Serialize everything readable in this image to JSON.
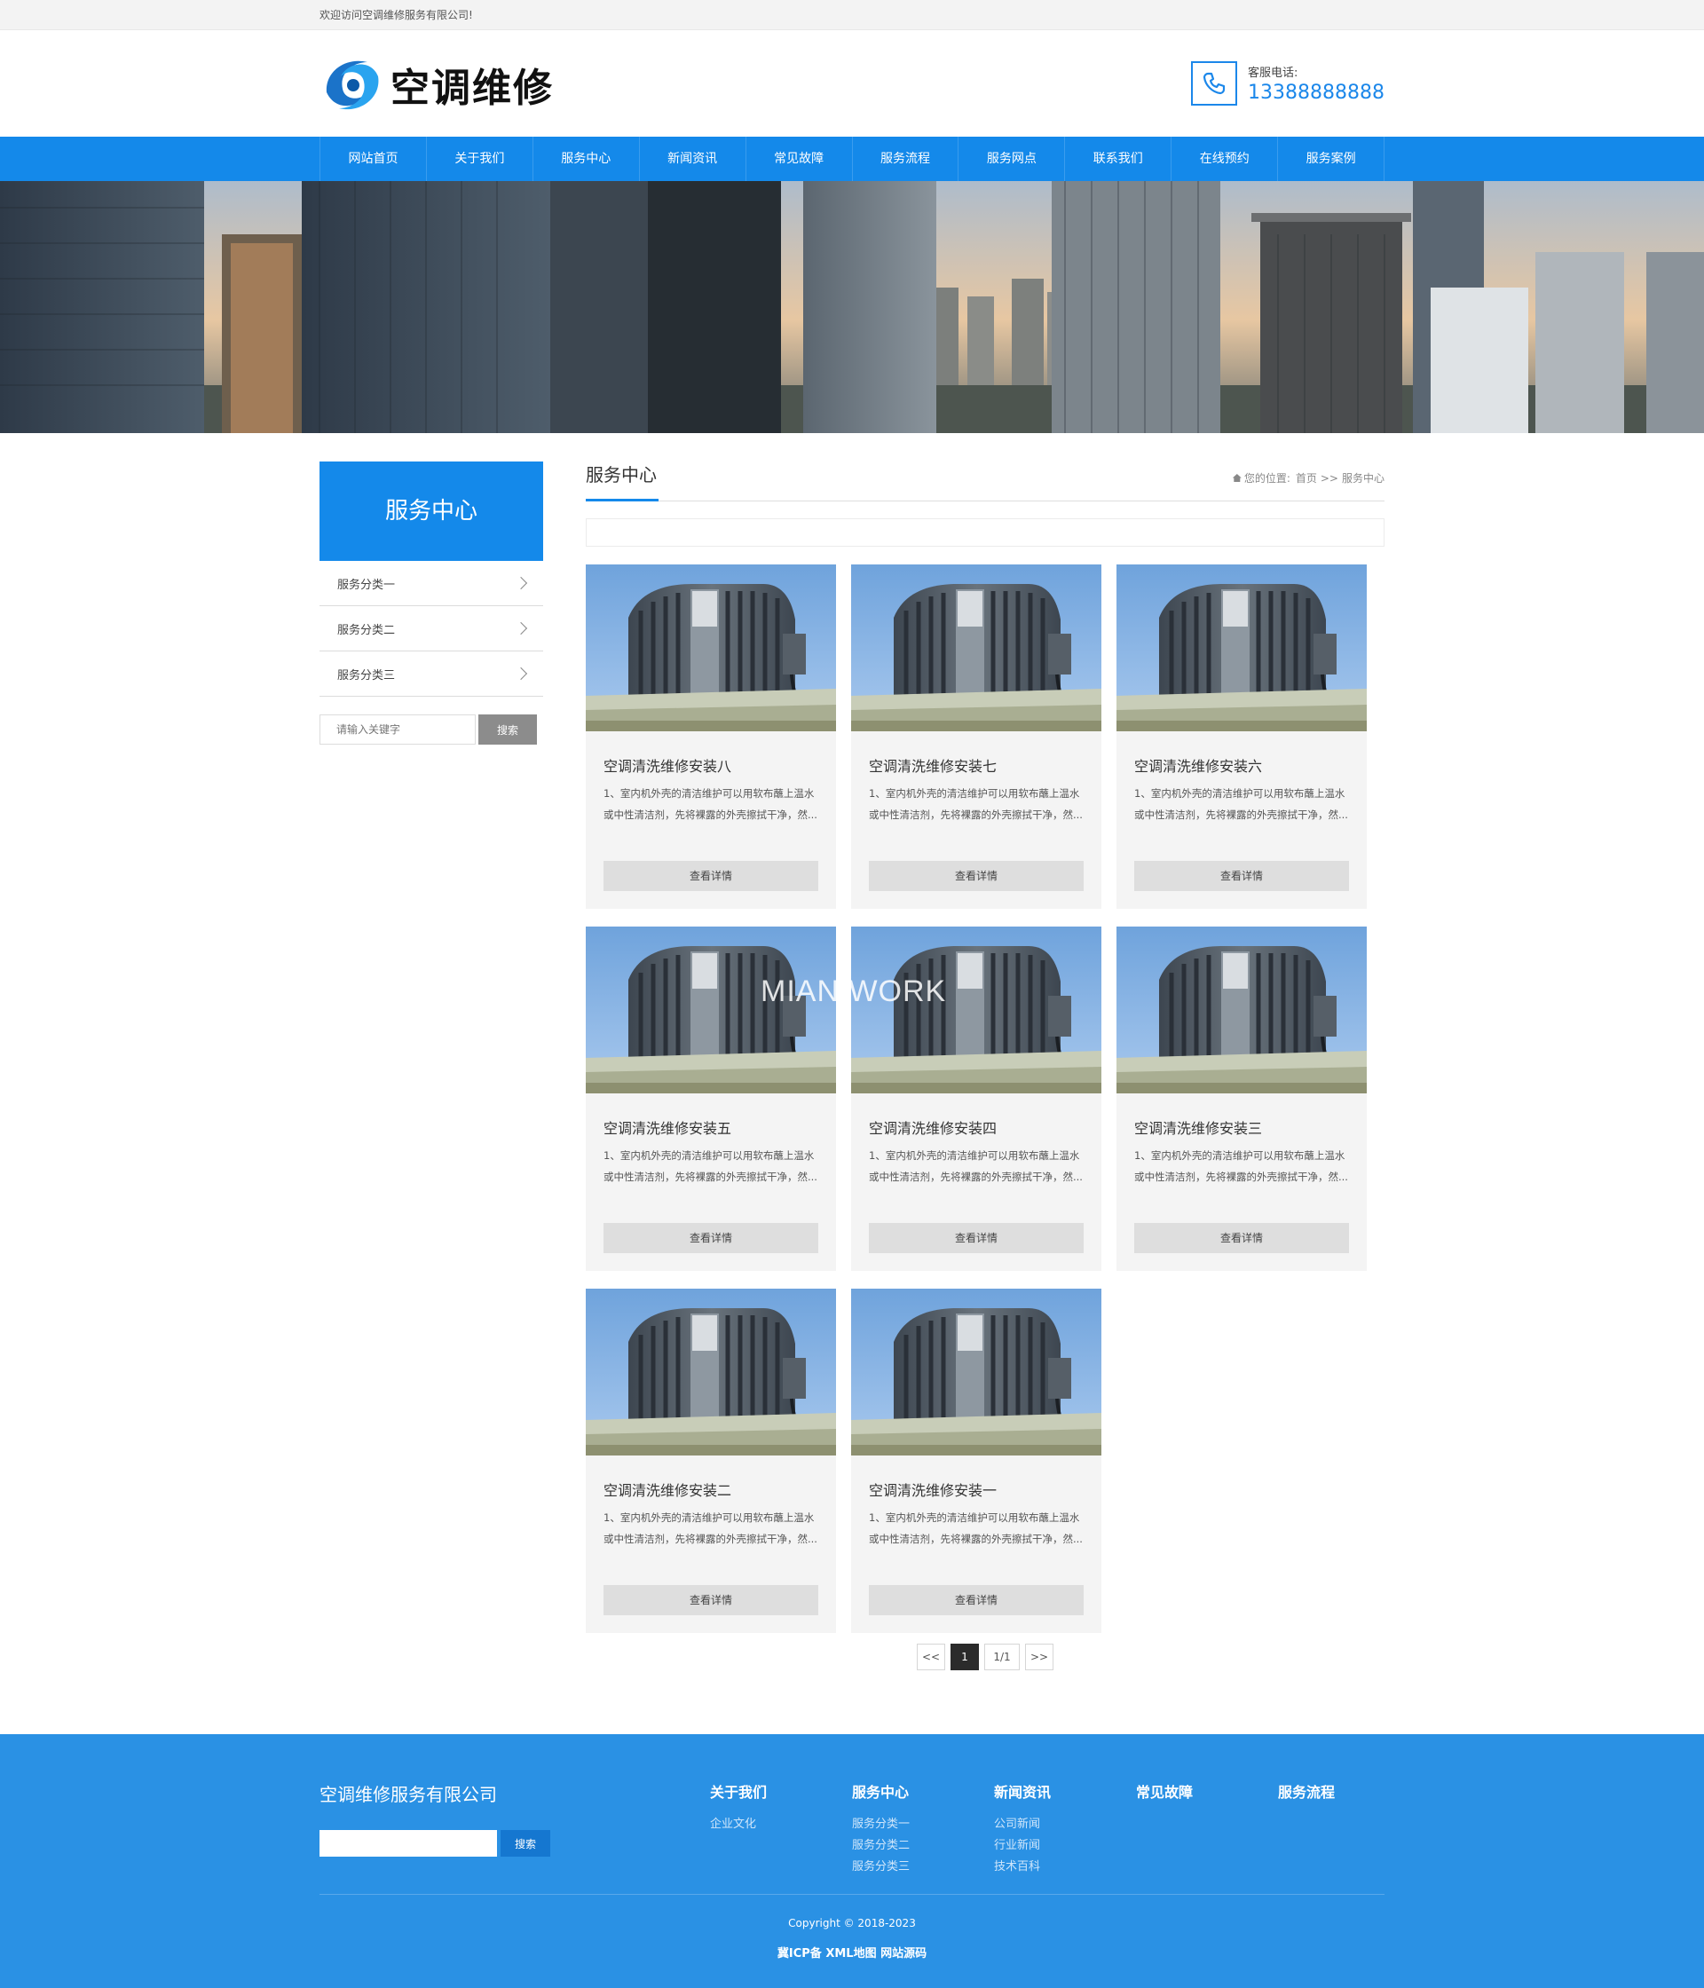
{
  "topbar": {
    "welcome": "欢迎访问空调维修服务有限公司!"
  },
  "header": {
    "logo_text": "空调维修",
    "phone_label": "客服电话:",
    "phone_number": "13388888888"
  },
  "nav": {
    "items": [
      "网站首页",
      "关于我们",
      "服务中心",
      "新闻资讯",
      "常见故障",
      "服务流程",
      "服务网点",
      "联系我们",
      "在线预约",
      "服务案例"
    ]
  },
  "sidebar": {
    "title": "服务中心",
    "items": [
      "服务分类一",
      "服务分类二",
      "服务分类三"
    ],
    "search_placeholder": "请输入关键字",
    "search_button": "搜索"
  },
  "main": {
    "title": "服务中心",
    "breadcrumb": {
      "prefix": "您的位置:",
      "home": "首页",
      "sep": ">>",
      "current": "服务中心"
    },
    "cards": [
      {
        "title": "空调清洗维修安装八",
        "desc": "1、室内机外壳的清洁维护可以用软布蘸上温水或中性清洁剂，先将裸露的外壳擦拭干净，然...",
        "button": "查看详情"
      },
      {
        "title": "空调清洗维修安装七",
        "desc": "1、室内机外壳的清洁维护可以用软布蘸上温水或中性清洁剂，先将裸露的外壳擦拭干净，然...",
        "button": "查看详情"
      },
      {
        "title": "空调清洗维修安装六",
        "desc": "1、室内机外壳的清洁维护可以用软布蘸上温水或中性清洁剂，先将裸露的外壳擦拭干净，然...",
        "button": "查看详情"
      },
      {
        "title": "空调清洗维修安装五",
        "desc": "1、室内机外壳的清洁维护可以用软布蘸上温水或中性清洁剂，先将裸露的外壳擦拭干净，然...",
        "button": "查看详情"
      },
      {
        "title": "空调清洗维修安装四",
        "desc": "1、室内机外壳的清洁维护可以用软布蘸上温水或中性清洁剂，先将裸露的外壳擦拭干净，然...",
        "button": "查看详情"
      },
      {
        "title": "空调清洗维修安装三",
        "desc": "1、室内机外壳的清洁维护可以用软布蘸上温水或中性清洁剂，先将裸露的外壳擦拭干净，然...",
        "button": "查看详情"
      },
      {
        "title": "空调清洗维修安装二",
        "desc": "1、室内机外壳的清洁维护可以用软布蘸上温水或中性清洁剂，先将裸露的外壳擦拭干净，然...",
        "button": "查看详情"
      },
      {
        "title": "空调清洗维修安装一",
        "desc": "1、室内机外壳的清洁维护可以用软布蘸上温水或中性清洁剂，先将裸露的外壳擦拭干净，然...",
        "button": "查看详情"
      }
    ],
    "pager": {
      "prev": "<<",
      "current": "1",
      "info": "1/1",
      "next": ">>"
    }
  },
  "watermark": "MIAN.WORK",
  "footer": {
    "company": "空调维修服务有限公司",
    "search_button": "搜索",
    "columns": [
      {
        "title": "关于我们",
        "links": [
          "企业文化"
        ]
      },
      {
        "title": "服务中心",
        "links": [
          "服务分类一",
          "服务分类二",
          "服务分类三"
        ]
      },
      {
        "title": "新闻资讯",
        "links": [
          "公司新闻",
          "行业新闻",
          "技术百科"
        ]
      },
      {
        "title": "常见故障",
        "links": []
      },
      {
        "title": "服务流程",
        "links": []
      }
    ],
    "copyright": "Copyright © 2018-2023",
    "bottom_links": "冀ICP备 XML地图 网站源码"
  },
  "colors": {
    "brand_blue": "#1489ea",
    "footer_blue": "#2a91e4",
    "card_bg": "#f4f4f4",
    "button_grey": "#dedede"
  }
}
